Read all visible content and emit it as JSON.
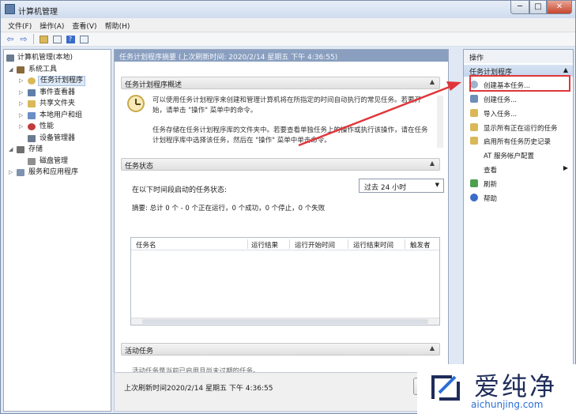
{
  "window": {
    "title": "计算机管理"
  },
  "caption": {
    "minimize": "─",
    "maximize": "□",
    "close": "✕"
  },
  "menu": [
    "文件(F)",
    "操作(A)",
    "查看(V)",
    "帮助(H)"
  ],
  "toolbar": {
    "icons": [
      "back-icon",
      "forward-icon",
      "up-folder-icon",
      "show-hide-tree-icon",
      "help-icon",
      "show-hide-action-pane-icon"
    ],
    "glyphs": {
      "back": "⇦",
      "forward": "⇨",
      "help": "?"
    }
  },
  "tree": {
    "root": "计算机管理(本地)",
    "items": [
      {
        "label": "系统工具",
        "toggle": "◢",
        "color": "#8a6a3a"
      },
      {
        "label": "任务计划程序",
        "toggle": "▷",
        "color": "#d9b858",
        "selected": true
      },
      {
        "label": "事件查看器",
        "toggle": "▷",
        "color": "#5f7fa9"
      },
      {
        "label": "共享文件夹",
        "toggle": "▷",
        "color": "#d9b858"
      },
      {
        "label": "本地用户和组",
        "toggle": "▷",
        "color": "#6a8fc4"
      },
      {
        "label": "性能",
        "toggle": "▷",
        "color": "#c23a3a"
      },
      {
        "label": "设备管理器",
        "toggle": "",
        "color": "#6b7a8f"
      },
      {
        "label": "存储",
        "toggle": "◢",
        "color": "#707070"
      },
      {
        "label": "磁盘管理",
        "toggle": "",
        "color": "#8f8f8f"
      },
      {
        "label": "服务和应用程序",
        "toggle": "▷",
        "color": "#7f93b0"
      }
    ]
  },
  "center": {
    "header": "任务计划程序摘要 (上次刷新时间: 2020/2/14 星期五 下午 4:36:55)",
    "overview": {
      "title": "任务计划程序概述",
      "p1": "可以使用任务计划程序来创建和管理计算机将在所指定的时间自动执行的常见任务。若要开始，请单击 \"操作\" 菜单中的命令。",
      "p2": "任务存储在任务计划程序库的文件夹中。若要查看单独任务上的操作或执行该操作，请在任务计划程序库中选择该任务，然后在 \"操作\" 菜单中单击命令。"
    },
    "status": {
      "title": "任务状态",
      "label": "在以下时间段启动的任务状态:",
      "period": "过去 24 小时",
      "summary": "摘要: 总计 0 个 - 0 个正在运行，0 个成功，0 个停止，0 个失败",
      "columns": [
        "任务名",
        "运行结果",
        "运行开始时间",
        "运行结束时间",
        "触发者"
      ]
    },
    "active": {
      "title": "活动任务",
      "truncated": "活动任务是当前已启用且尚未过期的任务。"
    },
    "collapse_glyph": "▲",
    "dropdown_glyph": "▼"
  },
  "bottom": {
    "last_refresh": "上次刷新时间2020/2/14 星期五 下午 4:36:55"
  },
  "actions": {
    "title": "操作",
    "group": "任务计划程序",
    "group_glyph": "▲",
    "items": [
      {
        "label": "创建基本任务...",
        "icon": "create-basic-task-icon",
        "color": "#9fb3cc"
      },
      {
        "label": "创建任务...",
        "icon": "create-task-icon",
        "color": "#6f8fb8"
      },
      {
        "label": "导入任务...",
        "icon": "import-task-icon",
        "color": "#d9b858"
      },
      {
        "label": "显示所有正在运行的任务",
        "icon": "running-tasks-icon",
        "color": "#d9b858"
      },
      {
        "label": "启用所有任务历史记录",
        "icon": "history-icon",
        "color": "#d9b858"
      },
      {
        "label": "AT 服务帐户配置",
        "icon": "",
        "color": ""
      },
      {
        "label": "查看",
        "icon": "",
        "color": "",
        "submenu": "▶"
      },
      {
        "label": "刷新",
        "icon": "refresh-icon",
        "color": "#4ea04e"
      },
      {
        "label": "帮助",
        "icon": "help-icon",
        "color": "#3a6bc9"
      }
    ]
  },
  "annotation": {
    "color": "#e0363a"
  },
  "watermark": {
    "text": "爱纯净",
    "url": "aichunjing.com",
    "color": "#1e2c5a",
    "url_color": "#2a6fd6"
  }
}
